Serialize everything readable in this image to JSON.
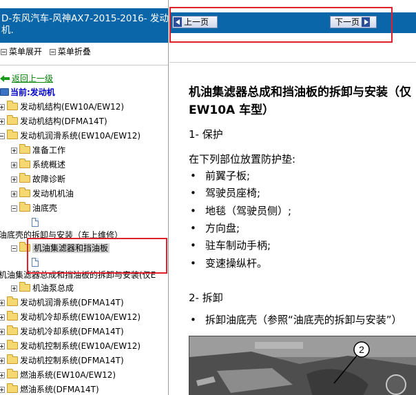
{
  "left_pane": {
    "title": "D-东风汽车-风神AX7-2015-2016- 发动机.",
    "toolbar": {
      "expand": "菜单展开",
      "collapse": "菜单折叠"
    },
    "back_link": "返回上一级",
    "current_label": "当前:发动机",
    "tree": [
      {
        "label": "发动机结构(EW10A/EW12)"
      },
      {
        "label": "发动机结构(DFMA14T)"
      },
      {
        "label": "发动机润滑系统(EW10A/EW12)"
      },
      {
        "label": "准备工作"
      },
      {
        "label": "系统概述"
      },
      {
        "label": "故障诊断"
      },
      {
        "label": "发动机机油"
      },
      {
        "label": "油底壳"
      },
      {
        "label": "油底壳的拆卸与安装（车上维修）"
      },
      {
        "label": "机油集滤器和挡油板"
      },
      {
        "label": "机油集滤器总成和挡油板的拆卸与安装(仅E"
      },
      {
        "label": "机油泵总成"
      },
      {
        "label": "发动机润滑系统(DFMA14T)"
      },
      {
        "label": "发动机冷却系统(EW10A/EW12)"
      },
      {
        "label": "发动机冷却系统(DFMA14T)"
      },
      {
        "label": "发动机控制系统(EW10A/EW12)"
      },
      {
        "label": "发动机控制系统(DFMA14T)"
      },
      {
        "label": "燃油系统(EW10A/EW12)"
      },
      {
        "label": "燃油系统(DFMA14T)"
      }
    ]
  },
  "nav": {
    "prev": "上一页",
    "next": "下一页"
  },
  "document": {
    "title": "机油集滤器总成和挡油板的拆卸与安装（仅 EW10A 车型）",
    "section1": "1- 保护",
    "protect_intro": "在下列部位放置防护垫:",
    "protect_items": [
      "前翼子板;",
      "驾驶员座椅;",
      "地毯（驾驶员侧）;",
      "方向盘;",
      "驻车制动手柄;",
      "变速操纵杆。"
    ],
    "section2": "2- 拆卸",
    "remove_items": [
      "拆卸油底壳（参照“油底壳的拆卸与安装”）"
    ],
    "callout": "2"
  },
  "colors": {
    "header_blue": "#0a66a8",
    "highlight_red": "#e0202a",
    "link_green": "#008000",
    "current_blue": "#0000c8"
  }
}
